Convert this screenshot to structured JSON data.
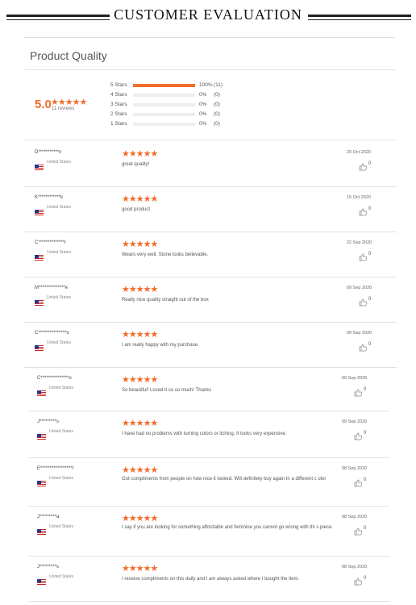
{
  "header": {
    "title": "CUSTOMER EVALUATION"
  },
  "section": {
    "title": "Product Quality"
  },
  "summary": {
    "score": "5.0",
    "stars": "★★★★★",
    "reviews_label": "11 reviews",
    "distribution": [
      {
        "label": "5 Stars",
        "percent": "100%",
        "count": "(11)",
        "fraction": 1.0
      },
      {
        "label": "4 Stars",
        "percent": "0%",
        "count": "(0)",
        "fraction": 0
      },
      {
        "label": "3 Stars",
        "percent": "0%",
        "count": "(0)",
        "fraction": 0
      },
      {
        "label": "2 Stars",
        "percent": "0%",
        "count": "(0)",
        "fraction": 0
      },
      {
        "label": "1 Stars",
        "percent": "0%",
        "count": "(0)",
        "fraction": 0
      }
    ]
  },
  "reviews": [
    {
      "name": "D***********n",
      "country": "United States",
      "stars": "★★★★★",
      "text": "great quality!",
      "date": "20 Oct 2020",
      "likes": "0"
    },
    {
      "name": "K************k",
      "country": "United States",
      "stars": "★★★★★",
      "text": "good product",
      "date": "15 Oct 2020",
      "likes": "0"
    },
    {
      "name": "C**************r",
      "country": "United States",
      "stars": "★★★★★",
      "text": "Wears very well. Stone looks believable.",
      "date": "22 Sep 2020",
      "likes": "0"
    },
    {
      "name": "M**************e",
      "country": "United States",
      "stars": "★★★★★",
      "text": "Really nice quality straight out of the box",
      "date": "09 Sep 2020",
      "likes": "0"
    },
    {
      "name": "C***************o",
      "country": "United States",
      "stars": "★★★★★",
      "text": "I am really happy with my purchase.",
      "date": "09 Sep 2020",
      "likes": "0"
    },
    {
      "name": "C***************o",
      "country": "United States",
      "stars": "★★★★★",
      "text": "So beautiful! Loved it so so much! Thanks",
      "date": "09 Sep 2020",
      "likes": "0"
    },
    {
      "name": "J*********s",
      "country": "United States",
      "stars": "★★★★★",
      "text": "I have had no problems with turning colors or itching. It looks very expensive.",
      "date": "09 Sep 2020",
      "likes": "0"
    },
    {
      "name": "E*****************l",
      "country": "United States",
      "stars": "★★★★★",
      "text": "Got compliments from people on how nice it looked. Will definitely buy again In a different c olor",
      "date": "08 Sep 2020",
      "likes": "0"
    },
    {
      "name": "J*********a",
      "country": "United States",
      "stars": "★★★★★",
      "text": "I say if you are looking for something affordable and feminine you cannot go wrong with thi s piece.",
      "date": "08 Sep 2020",
      "likes": "0"
    },
    {
      "name": "J*********s",
      "country": "United States",
      "stars": "★★★★★",
      "text": "I receive compliments on this daily and I am always asked where I bought the item.",
      "date": "08 Sep 2020",
      "likes": "0"
    }
  ]
}
